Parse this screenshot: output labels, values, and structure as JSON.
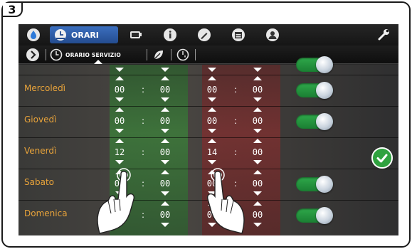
{
  "step_number": "3",
  "tabs": {
    "active_label": "ORARI",
    "items": [
      "water-drop-icon",
      "clock-icon",
      "cup-icon",
      "info-icon",
      "pencil-icon",
      "calendar-icon",
      "person-icon",
      "wrench-icon"
    ]
  },
  "subtabs": {
    "active_label": "ORARIO SERVIZIO"
  },
  "schedule": {
    "rows": [
      {
        "day": "",
        "on_h": "",
        "on_m": "",
        "off_h": "",
        "off_m": "",
        "enabled": true
      },
      {
        "day": "Mercoledì",
        "on_h": "00",
        "on_m": "00",
        "off_h": "00",
        "off_m": "00",
        "enabled": true
      },
      {
        "day": "Giovedì",
        "on_h": "00",
        "on_m": "00",
        "off_h": "00",
        "off_m": "00",
        "enabled": true
      },
      {
        "day": "Venerdì",
        "on_h": "12",
        "on_m": "00",
        "off_h": "14",
        "off_m": "00",
        "enabled": true
      },
      {
        "day": "Sabato",
        "on_h": "00",
        "on_m": "00",
        "off_h": "00",
        "off_m": "00",
        "enabled": true
      },
      {
        "day": "Domenica",
        "on_h": "00",
        "on_m": "00",
        "off_h": "00",
        "off_m": "00",
        "enabled": true
      }
    ],
    "separator": ":"
  },
  "colors": {
    "accent_blue": "#3b6fbf",
    "day_label": "#e8a33a",
    "toggle_on": "#2ea84a",
    "confirm": "#2fa23f"
  }
}
